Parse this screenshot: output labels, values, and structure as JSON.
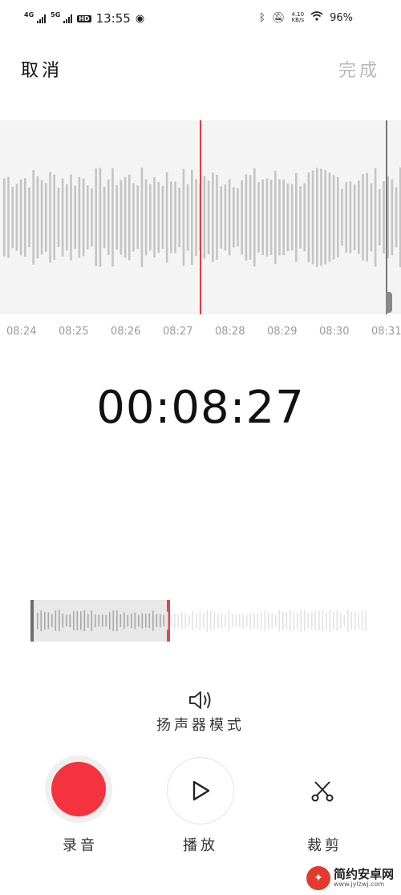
{
  "status_bar": {
    "time": "13:55",
    "network_1": "4G",
    "network_2": "5G",
    "hd": "HD",
    "speed_value": "4.10",
    "speed_unit": "KB/s",
    "battery": "96%"
  },
  "header": {
    "cancel_label": "取消",
    "done_label": "完成"
  },
  "timeline": {
    "ticks": [
      "08:24",
      "08:25",
      "08:26",
      "08:27",
      "08:28",
      "08:29",
      "08:30",
      "08:31"
    ]
  },
  "timer": "00:08:27",
  "speaker_mode_label": "扬声器模式",
  "controls": {
    "record_label": "录音",
    "play_label": "播放",
    "cut_label": "裁剪"
  },
  "watermark": {
    "name": "简约安卓网",
    "url": "www.jylzwj.com"
  },
  "colors": {
    "record": "#f5323f",
    "playhead": "#e23b3b",
    "done_disabled": "#b9b9b9"
  }
}
